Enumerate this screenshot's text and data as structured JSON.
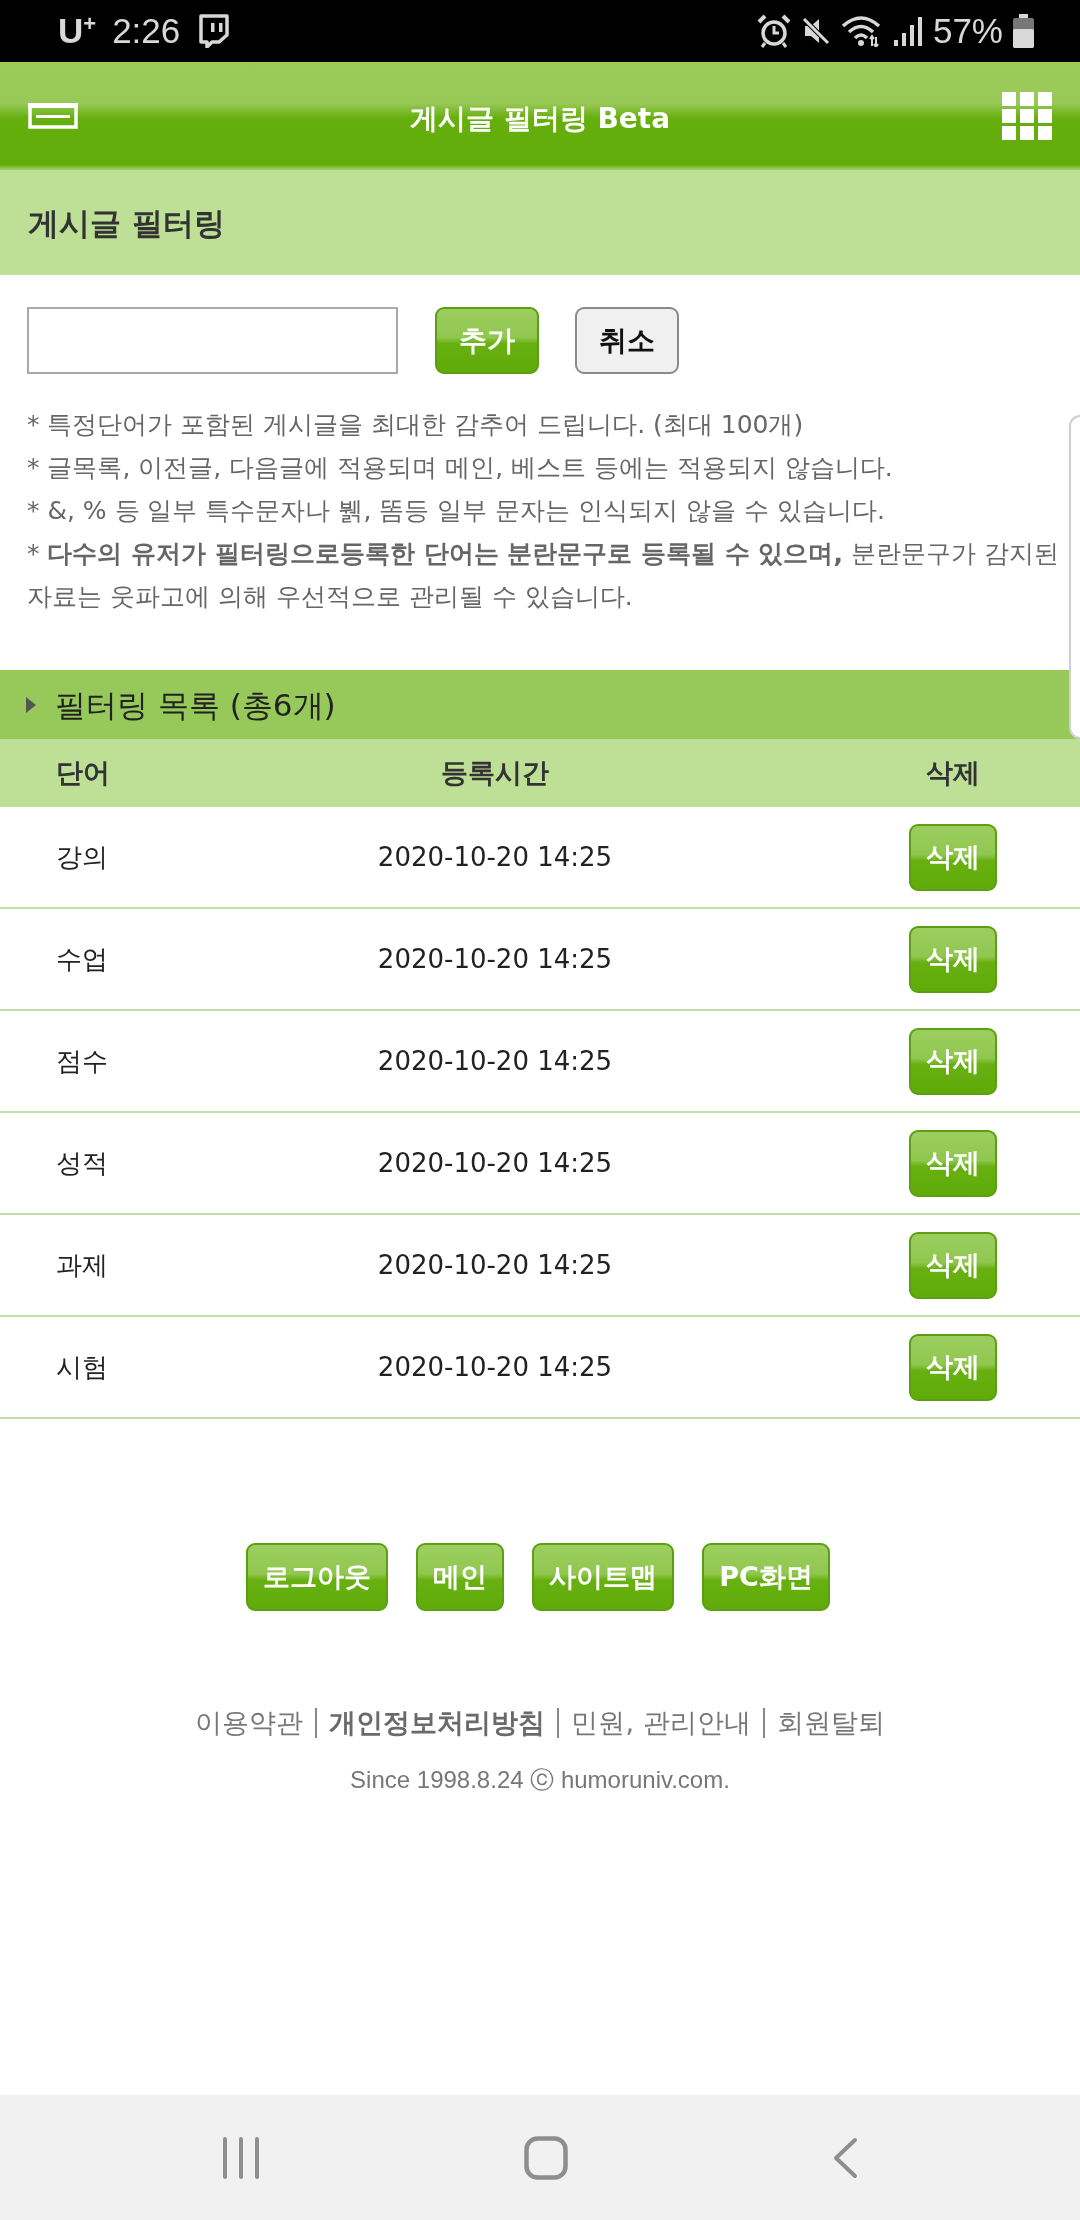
{
  "status_bar": {
    "carrier": "U$^{+}$",
    "time": "2:26",
    "battery_text": "57%"
  },
  "header": {
    "title": "게시글 필터링 Beta"
  },
  "page_title": "게시글 필터링",
  "filter_form": {
    "buttons": [
      {
        "label": "추가",
        "kind": "primary"
      },
      {
        "label": "취소",
        "kind": "secondary"
      }
    ]
  },
  "notes": [
    "* 특정단어가 포함된 게시글을 최대한 감추어 드립니다. (최대 100개)",
    "* 글목록, 이전글, 다음글에 적용되며 메인, 베스트 등에는 적용되지 않습니다.",
    "* &, % 등 일부 특수문자나 뷁, 똠등 일부 문자는 인식되지 않을 수 있습니다.",
    "* **다수의 유저가 필터링으로등록한 단어는 분란문구로 등록될 수 있으며,** 분란문구가 감지된 자료는 웃파고에 의해 우선적으로 관리될 수 있습니다."
  ],
  "filter_list": {
    "title": "필터링 목록 (총6개)",
    "columns": [
      "단어",
      "등록시간",
      "삭제"
    ],
    "rows": [
      {
        "word": "강의",
        "time": "2020-10-20 14:25",
        "delete_label": "삭제"
      },
      {
        "word": "수업",
        "time": "2020-10-20 14:25",
        "delete_label": "삭제"
      },
      {
        "word": "점수",
        "time": "2020-10-20 14:25",
        "delete_label": "삭제"
      },
      {
        "word": "성적",
        "time": "2020-10-20 14:25",
        "delete_label": "삭제"
      },
      {
        "word": "과제",
        "time": "2020-10-20 14:25",
        "delete_label": "삭제"
      },
      {
        "word": "시험",
        "time": "2020-10-20 14:25",
        "delete_label": "삭제"
      }
    ]
  },
  "footer": {
    "buttons": [
      "로그아웃",
      "메인",
      "사이트맵",
      "PC화면"
    ],
    "links": [
      {
        "label": "이용약관",
        "emphasized": false
      },
      {
        "label": "개인정보처리방침",
        "emphasized": true
      },
      {
        "label": "민원, 관리안내",
        "emphasized": false
      },
      {
        "label": "회원탈퇴",
        "emphasized": false
      }
    ],
    "copyright": "Since 1998.8.24 ⓒ humoruniv.com."
  }
}
